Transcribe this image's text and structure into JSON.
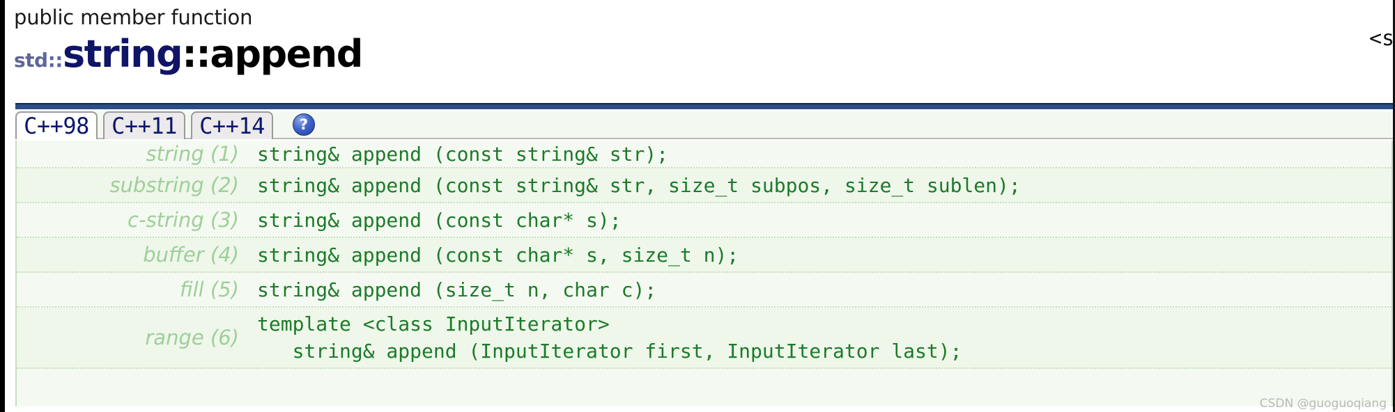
{
  "header": {
    "kind": "public member function",
    "namespace": "std::",
    "class": "string",
    "member": "::append",
    "include_link": "<s"
  },
  "tabs": [
    {
      "label": "C++98",
      "active": true
    },
    {
      "label": "C++11",
      "active": false
    },
    {
      "label": "C++14",
      "active": false
    }
  ],
  "help": {
    "glyph": "?",
    "name": "help-icon"
  },
  "signatures": {
    "rows": [
      {
        "label": "string (1)",
        "code": "string& append (const string& str);"
      },
      {
        "label": "substring (2)",
        "code": "string& append (const string& str, size_t subpos, size_t sublen);"
      },
      {
        "label": "c-string (3)",
        "code": "string& append (const char* s);"
      },
      {
        "label": "buffer (4)",
        "code": "string& append (const char* s, size_t n);"
      },
      {
        "label": "fill (5)",
        "code": "string& append (size_t n, char c);"
      },
      {
        "label": "range (6)",
        "code": "template <class InputIterator>\n   string& append (InputIterator first, InputIterator last);"
      }
    ]
  },
  "watermark": "CSDN @guoguoqiang",
  "colors": {
    "navy_rule": "#2e4d86",
    "title_class": "#0f1466",
    "title_namespace": "#5f6699",
    "code_green": "#1d7a2a",
    "label_green": "#9fcf9a",
    "row_bg": "#f4faf1",
    "row_bg_alt": "#eef7ea",
    "tab_text": "#0b1670"
  }
}
